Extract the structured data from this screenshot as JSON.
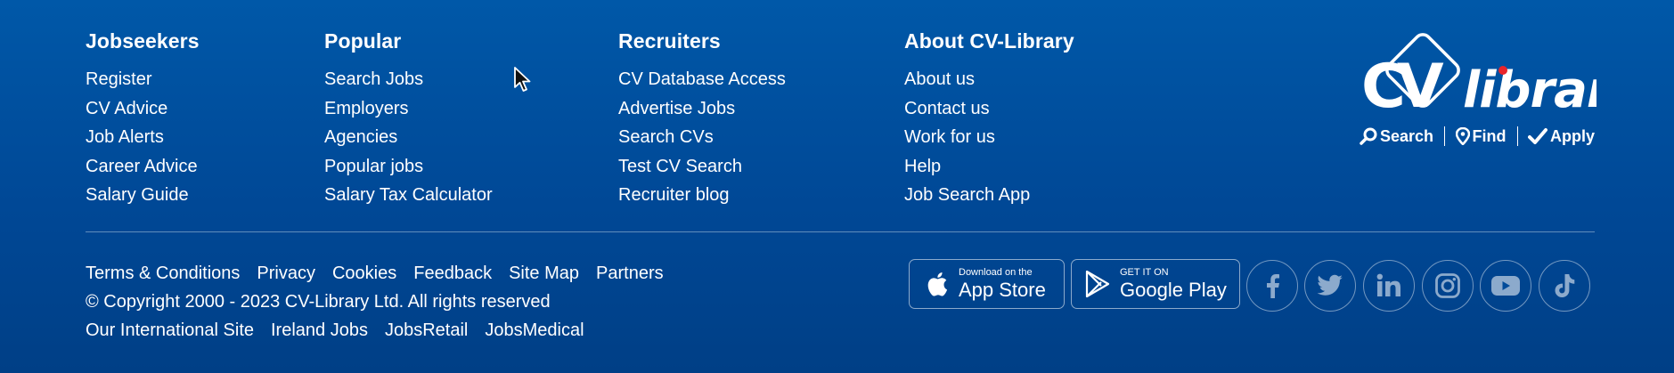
{
  "columns": [
    {
      "heading": "Jobseekers",
      "links": [
        "Register",
        "CV Advice",
        "Job Alerts",
        "Career Advice",
        "Salary Guide"
      ]
    },
    {
      "heading": "Popular",
      "links": [
        "Search Jobs",
        "Employers",
        "Agencies",
        "Popular jobs",
        "Salary Tax Calculator"
      ]
    },
    {
      "heading": "Recruiters",
      "links": [
        "CV Database Access",
        "Advertise Jobs",
        "Search CVs",
        "Test CV Search",
        "Recruiter blog"
      ]
    },
    {
      "heading": "About CV-Library",
      "links": [
        "About us",
        "Contact us",
        "Work for us",
        "Help",
        "Job Search App"
      ]
    }
  ],
  "brand": {
    "logo_text": "CV Library",
    "tagline": [
      "Search",
      "Find",
      "Apply"
    ]
  },
  "legal_links": [
    "Terms & Conditions",
    "Privacy",
    "Cookies",
    "Feedback",
    "Site Map",
    "Partners"
  ],
  "copyright": "© Copyright 2000 - 2023 CV-Library Ltd. All rights reserved",
  "intl_links": [
    "Our International Site",
    "Ireland Jobs",
    "JobsRetail",
    "JobsMedical"
  ],
  "app_store": {
    "small": "Download on the",
    "big": "App Store"
  },
  "google_play": {
    "small": "GET IT ON",
    "big": "Google Play"
  },
  "social_icons": [
    "facebook-icon",
    "twitter-icon",
    "linkedin-icon",
    "instagram-icon",
    "youtube-icon",
    "tiktok-icon"
  ],
  "colors": {
    "background": "#004b9a",
    "text": "#ffffff"
  }
}
